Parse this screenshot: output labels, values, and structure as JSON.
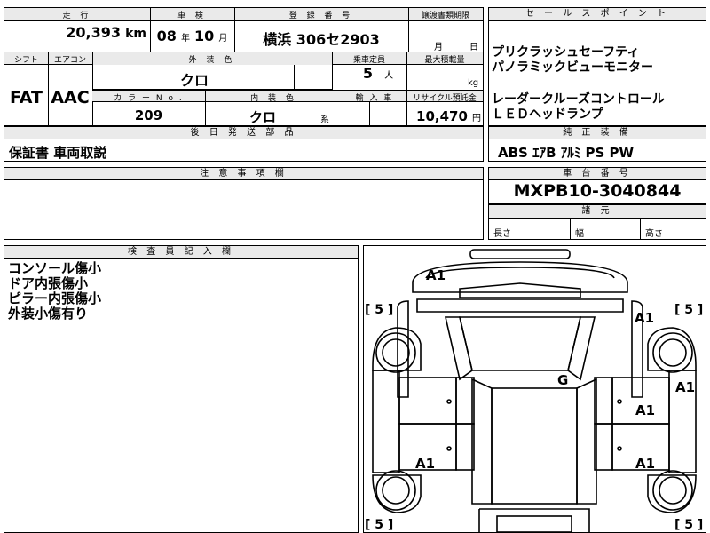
{
  "top": {
    "labels": {
      "mileage": "走 行",
      "inspection": "車 検",
      "registration": "登 録 番 号",
      "transfer_deadline": "譲渡書類期限",
      "shift": "シフト",
      "aircon": "エアコン",
      "exterior_color": "外 装 色",
      "capacity": "乗車定員",
      "max_load": "最大積載量",
      "color_no": "カ ラ ー N o .",
      "interior_color": "内 装 色",
      "import": "輸 入 車",
      "recycle": "リサイクル預託金",
      "later_parts": "後 日 発 送 部 品"
    },
    "mileage": "20,393",
    "mileage_unit": "km",
    "inspection_year": "08",
    "year_unit": "年",
    "inspection_month": "10",
    "month_unit": "月",
    "plate": "横浜 306セ2903",
    "transfer_month_unit": "月",
    "transfer_day_unit": "日",
    "shift": "FAT",
    "aircon": "AAC",
    "exterior_color": "クロ",
    "capacity": "5",
    "capacity_unit": "人",
    "max_load_unit": "kg",
    "color_no": "209",
    "interior_color": "クロ",
    "interior_suffix": "系",
    "recycle": "10,470",
    "recycle_unit": "円",
    "later_parts": "保証書 車両取説"
  },
  "sales": {
    "header": "セ ー ル ス ポ イ ン ト",
    "lines": [
      "プリクラッシュセーフティ",
      "パノラミックビューモニター",
      "レーダークルーズコントロール",
      "ＬＥＤヘッドランプ"
    ]
  },
  "equipment": {
    "header": "純 正 装 備",
    "value": "ABS ｴｱB ｱﾙﾐ PS PW"
  },
  "notes": {
    "header": "注 意 事 項 欄"
  },
  "chassis": {
    "header": "車 台 番 号",
    "value": "MXPB10-3040844"
  },
  "specs": {
    "header": "諸 元",
    "length": "長さ",
    "width": "幅",
    "height": "高さ"
  },
  "inspector": {
    "header": "検 査 員 記 入 欄",
    "lines": [
      "コンソール傷小",
      "ドア内張傷小",
      "ピラー内張傷小",
      "外装小傷有り"
    ]
  },
  "diagram": {
    "marks": [
      "A1",
      "A1",
      "A1",
      "A1",
      "A1",
      "A1",
      "G"
    ],
    "tyres": [
      "[ 5 ]",
      "[ 5 ]",
      "[ 5 ]",
      "[ 5 ]"
    ]
  }
}
